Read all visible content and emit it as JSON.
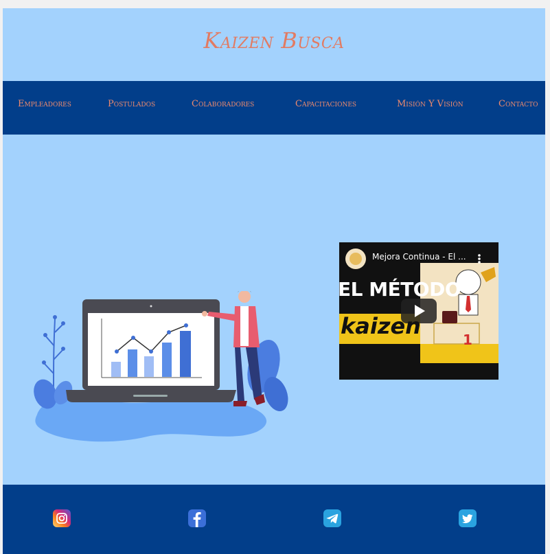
{
  "site": {
    "title": "Kaizen Busca"
  },
  "nav": {
    "items": [
      {
        "label": "Empleadores"
      },
      {
        "label": "Postulados"
      },
      {
        "label": "Colaboradores"
      },
      {
        "label": "Capacitaciones"
      },
      {
        "label": "Misión Y Visión"
      },
      {
        "label": "Contacto"
      }
    ]
  },
  "video": {
    "title": "Mejora Continua - El ...",
    "thumbnail_text_1": "EL MÉTODO",
    "thumbnail_text_2": "kaizen",
    "podium_number": "1"
  },
  "footer": {
    "social": [
      "instagram-icon",
      "facebook-icon",
      "telegram-icon",
      "twitter-icon"
    ]
  },
  "colors": {
    "background": "#a3d2fd",
    "nav_background": "#023e8a",
    "accent": "#e27b62"
  }
}
